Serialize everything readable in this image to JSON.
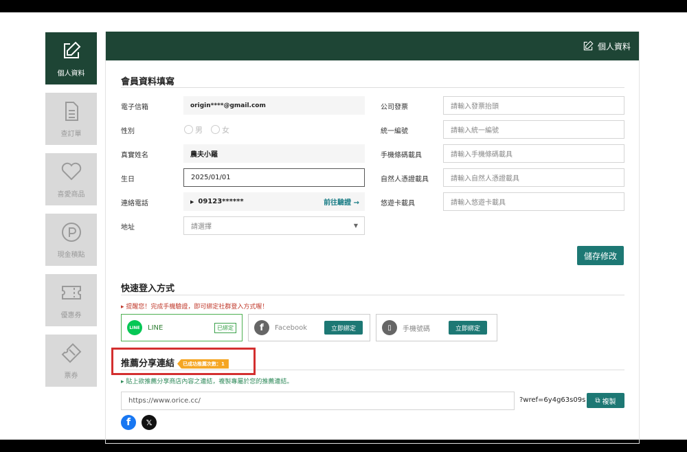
{
  "sidebar": {
    "items": [
      {
        "label": "個人資料",
        "icon": "edit-icon"
      },
      {
        "label": "查訂單",
        "icon": "document-icon"
      },
      {
        "label": "喜愛商品",
        "icon": "heart-icon"
      },
      {
        "label": "現金積點",
        "icon": "points-icon"
      },
      {
        "label": "優惠券",
        "icon": "coupon-icon"
      },
      {
        "label": "票券",
        "icon": "ticket-icon"
      }
    ]
  },
  "header": {
    "title": "個人資料"
  },
  "profile": {
    "section_title": "會員資料填寫",
    "email_label": "電子信箱",
    "email_value": "origin****@gmail.com",
    "gender_label": "性別",
    "gender_male": "男",
    "gender_female": "女",
    "name_label": "真實姓名",
    "name_value": "農夫小羅",
    "birthday_label": "生日",
    "birthday_value": "2025/01/01",
    "phone_label": "連絡電話",
    "phone_value": "09123******",
    "phone_verify": "前往驗證 →",
    "address_label": "地址",
    "address_placeholder": "請選擇",
    "invoice_label": "公司發票",
    "invoice_placeholder": "請輸入發票抬頭",
    "tax_label": "統一編號",
    "tax_placeholder": "請輸入統一編號",
    "mobile_barcode_label": "手機條碼載具",
    "mobile_barcode_placeholder": "請輸入手機條碼載具",
    "citizen_cert_label": "自然人憑證載具",
    "citizen_cert_placeholder": "請輸入自然人憑證載具",
    "easycard_label": "悠遊卡載具",
    "easycard_placeholder": "請輸入悠遊卡載具",
    "save_button": "儲存修改"
  },
  "quick_login": {
    "section_title": "快速登入方式",
    "reminder": "▸ 提醒您！完成手機驗證，即可綁定社群登入方式喔！",
    "line_label": "LINE",
    "line_status": "已綁定",
    "facebook_label": "Facebook",
    "facebook_button": "立即綁定",
    "phone_label": "手機號碼",
    "phone_button": "立即綁定"
  },
  "referral": {
    "section_title": "推薦分享連結",
    "badge": "已成功推薦次數：1",
    "note": "▸ 貼上欲推薦分享商店內容之連結，複製專屬於您的推薦連結。",
    "url_value": "https://www.orice.cc/",
    "wref": "?wref=6y4g63s09s",
    "copy_button": "複製"
  },
  "colors": {
    "brand": "#1e4535",
    "accent": "#1d7874",
    "highlight": "#d32f2f",
    "badge": "#f5a623"
  }
}
